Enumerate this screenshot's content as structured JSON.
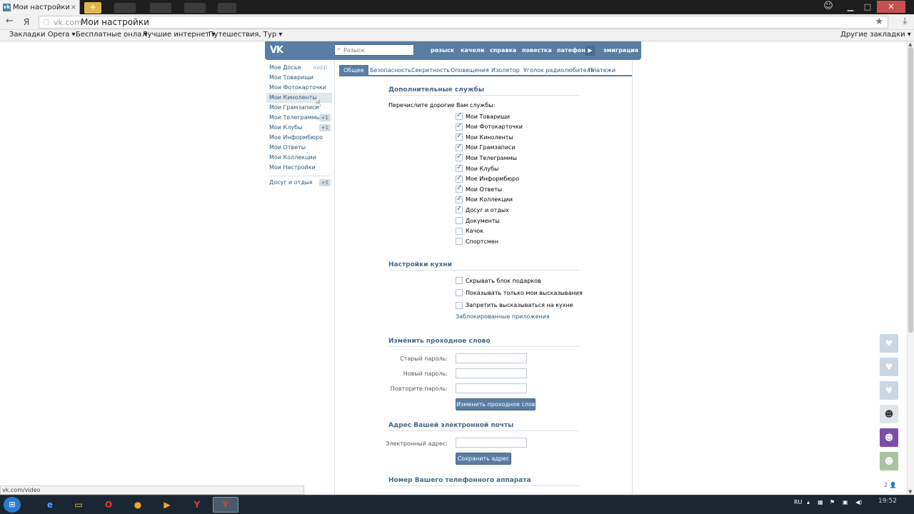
{
  "browser": {
    "tab_title": "Мои настройки",
    "tab_close": "×",
    "new_tab": "+",
    "url_prefix": "Я",
    "url_host": "vk.com",
    "url_title": "Мои настройки",
    "bookmarks": [
      "Закладки Opera ▾",
      "Бесплатные онла ▾",
      "Лучшие интернет ▾",
      "Путешествия, Тур ▾"
    ],
    "other_bookmarks": "Другие закладки ▾",
    "status_url": "vk.com/video"
  },
  "header": {
    "logo": "VK",
    "search_placeholder": "Розыск",
    "nav": [
      "розыск",
      "качели",
      "справка",
      "повестка",
      "патефон",
      "эмиграция"
    ]
  },
  "sidebar": {
    "items": [
      {
        "label": "Мое Досье",
        "extra": "корр."
      },
      {
        "label": "Мои Товарищи"
      },
      {
        "label": "Мои Фотокарточки"
      },
      {
        "label": "Мои Киноленты"
      },
      {
        "label": "Мои Грамзаписи"
      },
      {
        "label": "Мои Телеграммы",
        "badge": "+1"
      },
      {
        "label": "Мои Клубы",
        "badge": "+1"
      },
      {
        "label": "Мое Информбюро"
      },
      {
        "label": "Мои Ответы"
      },
      {
        "label": "Мои Коллекции"
      },
      {
        "label": "Мои Настройки"
      }
    ],
    "extra_item": {
      "label": "Досуг и отдых",
      "badge": "+5"
    }
  },
  "tabs": [
    "Общее",
    "Безопасность",
    "Секретность",
    "Оповещения",
    "Изолятор",
    "Уголок радиолюбителя",
    "Платежи"
  ],
  "services": {
    "title": "Дополнительные службы",
    "subtitle": "Перечислите дорогие Вам службы:",
    "items": [
      {
        "label": "Мои Товарищи",
        "checked": true
      },
      {
        "label": "Мои Фотокарточки",
        "checked": true
      },
      {
        "label": "Мои Киноленты",
        "checked": true
      },
      {
        "label": "Мои Грамзаписи",
        "checked": true
      },
      {
        "label": "Мои Телеграммы",
        "checked": true
      },
      {
        "label": "Мои Клубы",
        "checked": true
      },
      {
        "label": "Мое Информбюро",
        "checked": true
      },
      {
        "label": "Мои Ответы",
        "checked": true
      },
      {
        "label": "Мои Коллекции",
        "checked": true
      },
      {
        "label": "Досуг и отдых",
        "checked": true
      },
      {
        "label": "Документы",
        "checked": false
      },
      {
        "label": "Качок",
        "checked": false
      },
      {
        "label": "Спортсмен",
        "checked": false
      }
    ]
  },
  "kitchen": {
    "title": "Настройки кухни",
    "items": [
      {
        "label": "Скрывать блок подарков",
        "checked": false
      },
      {
        "label": "Показывать только мои высказывания",
        "checked": false
      },
      {
        "label": "Запретить высказываться на кухне",
        "checked": false
      }
    ],
    "blocked_link": "Заблокированные приложения"
  },
  "password": {
    "title": "Изменить проходное слово",
    "old_label": "Старый пароль:",
    "new_label": "Новый пароль:",
    "repeat_label": "Повторите пароль:",
    "button": "Изменить проходное слово"
  },
  "email": {
    "title": "Адрес Вашей электронной почты",
    "label": "Электронный адрес:",
    "button": "Сохранить адрес"
  },
  "phone": {
    "title": "Номер Вашего телефонного аппарата"
  },
  "friends_count": "2 👤",
  "taskbar": {
    "lang": "RU",
    "clock": "19:52"
  }
}
